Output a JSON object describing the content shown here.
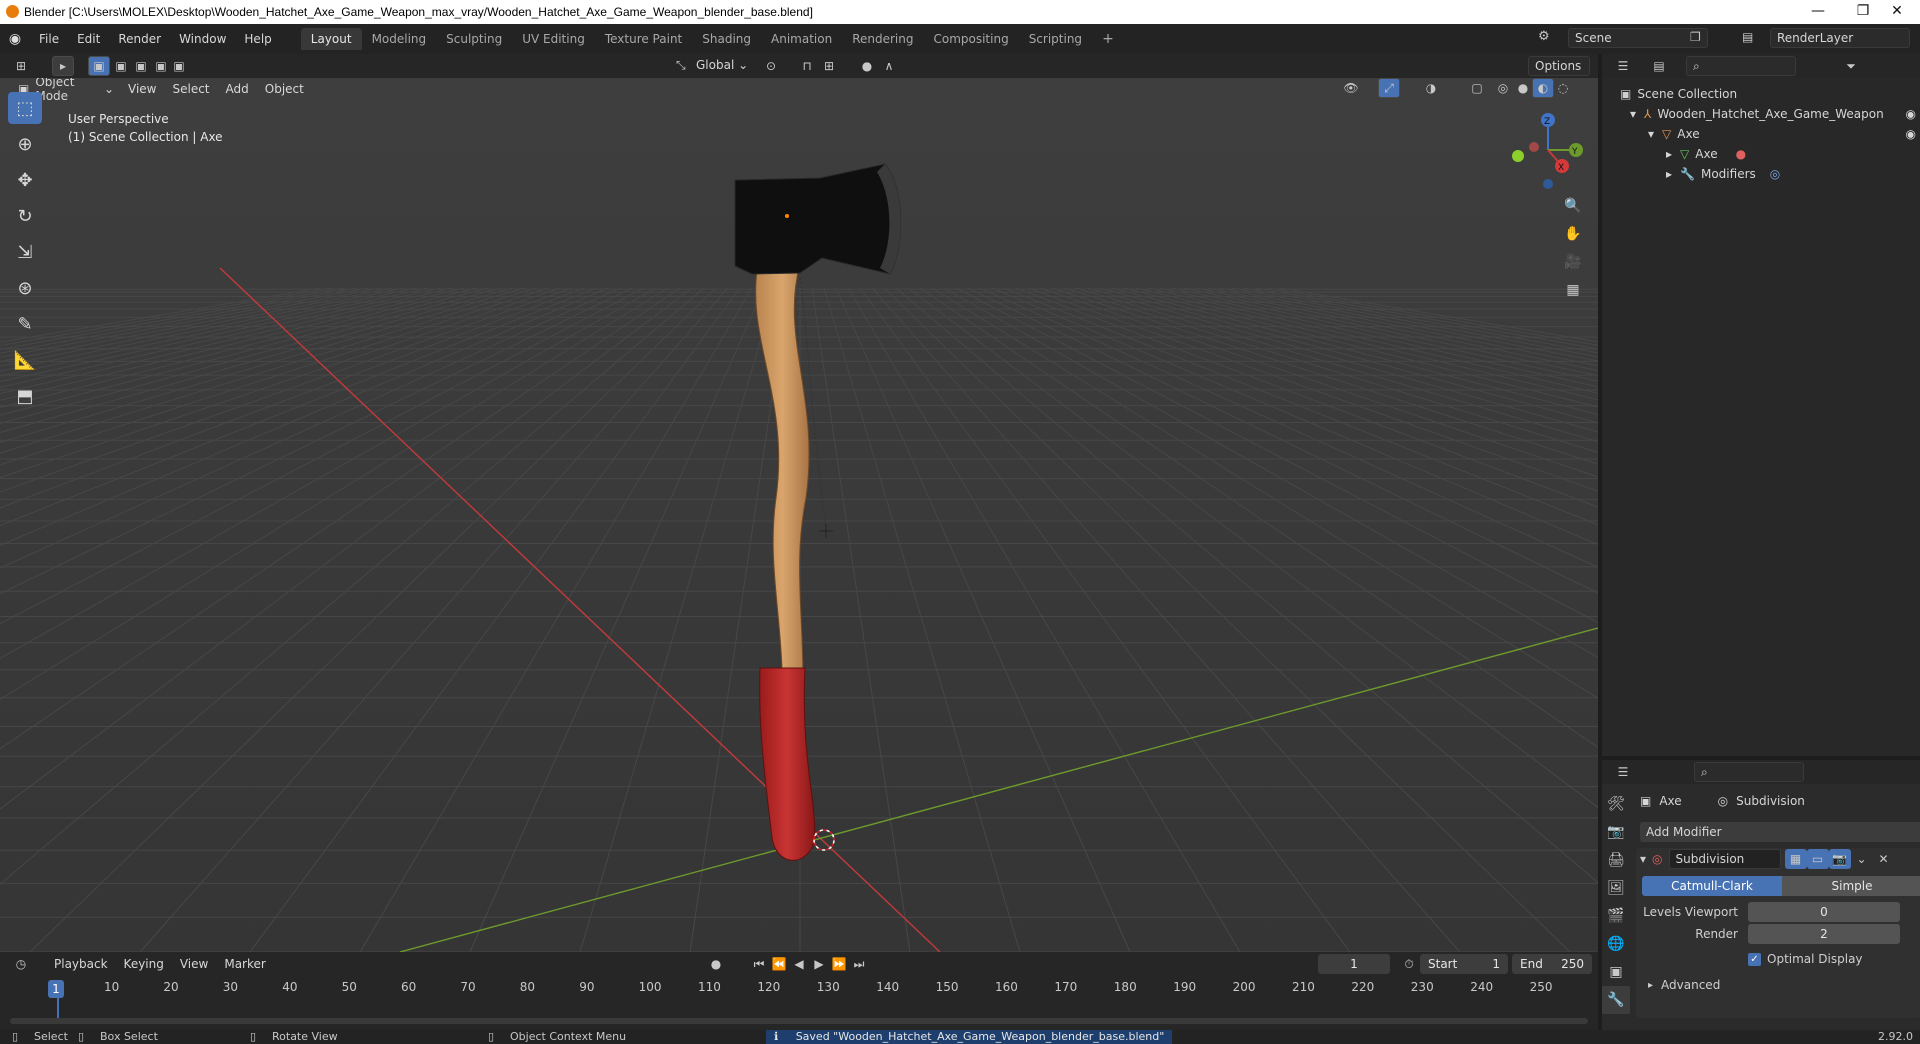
{
  "window": {
    "title": "Blender [C:\\Users\\MOLEX\\Desktop\\Wooden_Hatchet_Axe_Game_Weapon_max_vray/Wooden_Hatchet_Axe_Game_Weapon_blender_base.blend]",
    "minimize": "—",
    "restore": "❐",
    "close": "✕"
  },
  "menu": {
    "items": [
      "File",
      "Edit",
      "Render",
      "Window",
      "Help"
    ],
    "workspaces": [
      "Layout",
      "Modeling",
      "Sculpting",
      "UV Editing",
      "Texture Paint",
      "Shading",
      "Animation",
      "Rendering",
      "Compositing",
      "Scripting"
    ],
    "add_workspace": "+",
    "scene": "Scene",
    "render_layer": "RenderLayer"
  },
  "toolheader": {
    "transform_orientation": "Global",
    "options": "Options"
  },
  "viewport_header": {
    "mode": "Object Mode",
    "menus": [
      "View",
      "Select",
      "Add",
      "Object"
    ]
  },
  "viewport": {
    "perspective": "User Perspective",
    "collection": "(1) Scene Collection | Axe",
    "gizmo_labels": {
      "z": "Z",
      "y": "Y",
      "x": "X"
    }
  },
  "outliner": {
    "root": "Scene Collection",
    "collection": "Wooden_Hatchet_Axe_Game_Weapon",
    "object": "Axe",
    "mesh": "Axe",
    "modifiers": "Modifiers"
  },
  "properties": {
    "object_name": "Axe",
    "modifier_tab": "Subdivision",
    "add_modifier": "Add Modifier",
    "modifier_name": "Subdivision",
    "type_options": [
      "Catmull-Clark",
      "Simple"
    ],
    "selected_type": "Catmull-Clark",
    "levels_viewport_label": "Levels Viewport",
    "levels_viewport_value": "0",
    "render_label": "Render",
    "render_value": "2",
    "optimal_display_label": "Optimal Display",
    "optimal_display_checked": true,
    "advanced_label": "Advanced"
  },
  "timeline": {
    "menus": [
      "Playback",
      "Keying",
      "View",
      "Marker"
    ],
    "current_frame": "1",
    "start_label": "Start",
    "start_value": "1",
    "end_label": "End",
    "end_value": "250",
    "ticks": [
      "10",
      "20",
      "30",
      "40",
      "50",
      "60",
      "70",
      "80",
      "90",
      "100",
      "110",
      "120",
      "130",
      "140",
      "150",
      "160",
      "170",
      "180",
      "190",
      "200",
      "210",
      "220",
      "230",
      "240",
      "250"
    ],
    "playhead": "1"
  },
  "statusbar": {
    "select": "Select",
    "box_select": "Box Select",
    "rotate_view": "Rotate View",
    "context_menu": "Object Context Menu",
    "message": "Saved \"Wooden_Hatchet_Axe_Game_Weapon_blender_base.blend\"",
    "version": "2.92.0"
  },
  "colors": {
    "accent": "#4772b3",
    "x_axis": "#c43a3a",
    "y_axis": "#6d9a2c",
    "z_axis": "#3f74c8"
  }
}
